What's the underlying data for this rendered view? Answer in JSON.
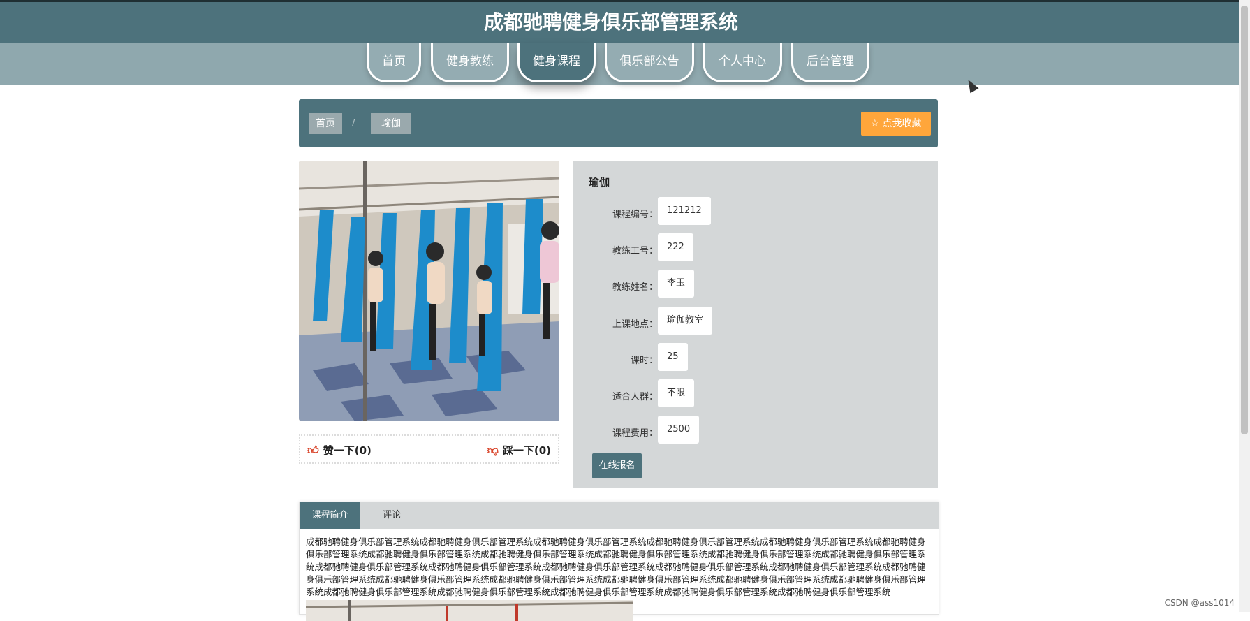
{
  "site": {
    "title": "成都驰聘健身俱乐部管理系统"
  },
  "nav": {
    "items": [
      {
        "label": "首页"
      },
      {
        "label": "健身教练"
      },
      {
        "label": "健身课程"
      },
      {
        "label": "俱乐部公告"
      },
      {
        "label": "个人中心"
      },
      {
        "label": "后台管理"
      }
    ],
    "active_index": 2
  },
  "breadcrumb": {
    "home": "首页",
    "separator": "/",
    "current": "瑜伽"
  },
  "favorite_button": {
    "icon": "star-outline-icon",
    "label": "点我收藏"
  },
  "course": {
    "title": "瑜伽",
    "fields": [
      {
        "label": "课程编号：",
        "value": "121212"
      },
      {
        "label": "教练工号：",
        "value": "222"
      },
      {
        "label": "教练姓名：",
        "value": "李玉"
      },
      {
        "label": "上课地点：",
        "value": "瑜伽教室"
      },
      {
        "label": "课时：",
        "value": "25"
      },
      {
        "label": "适合人群：",
        "value": "不限"
      },
      {
        "label": "课程费用：",
        "value": "2500"
      }
    ],
    "signup_label": "在线报名"
  },
  "votes": {
    "like": {
      "icon": "thumbs-up-icon",
      "label": "赞一下(0)"
    },
    "dislike": {
      "icon": "thumbs-down-icon",
      "label": "踩一下(0)"
    }
  },
  "tabs": {
    "items": [
      {
        "label": "课程简介"
      },
      {
        "label": "评论"
      }
    ],
    "active_index": 0,
    "intro_text": "成都驰聘健身俱乐部管理系统成都驰聘健身俱乐部管理系统成都驰聘健身俱乐部管理系统成都驰聘健身俱乐部管理系统成都驰聘健身俱乐部管理系统成都驰聘健身俱乐部管理系统成都驰聘健身俱乐部管理系统成都驰聘健身俱乐部管理系统成都驰聘健身俱乐部管理系统成都驰聘健身俱乐部管理系统成都驰聘健身俱乐部管理系统成都驰聘健身俱乐部管理系统成都驰聘健身俱乐部管理系统成都驰聘健身俱乐部管理系统成都驰聘健身俱乐部管理系统成都驰聘健身俱乐部管理系统成都驰聘健身俱乐部管理系统成都驰聘健身俱乐部管理系统成都驰聘健身俱乐部管理系统成都驰聘健身俱乐部管理系统成都驰聘健身俱乐部管理系统成都驰聘健身俱乐部管理系统成都驰聘健身俱乐部管理系统成都驰聘健身俱乐部管理系统成都驰聘健身俱乐部管理系统成都驰聘健身俱乐部管理系统成都驰聘健身俱乐部管理系统"
  },
  "watermark": "CSDN @ass1014",
  "colors": {
    "primary": "#4d727c",
    "nav_bg": "#8fa8ae",
    "panel_bg": "#d4d7d8",
    "accent": "#ffa63b"
  }
}
